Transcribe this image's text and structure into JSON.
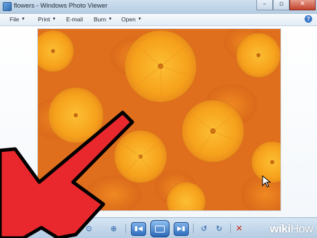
{
  "window": {
    "title": "flowers - Windows Photo Viewer",
    "controls": [
      "–",
      "▫",
      "✕"
    ]
  },
  "menu": {
    "items": [
      {
        "label": "File",
        "caret": "▼"
      },
      {
        "label": "Print",
        "caret": "▼"
      },
      {
        "label": "E-mail",
        "caret": ""
      },
      {
        "label": "Burn",
        "caret": "▼"
      },
      {
        "label": "Open",
        "caret": "▼"
      }
    ],
    "help": "?"
  },
  "photo": {
    "description_icon": "flowers-photo",
    "colors": {
      "background": "#e3771a",
      "petal": "#f7a01c",
      "petal_light": "#fbb52c",
      "center": "#c76a12"
    }
  },
  "toolbar": {
    "zoom_icon": "zoom-icon",
    "fit_icon": "actual-size-icon",
    "prev_icon": "previous-icon",
    "slideshow_icon": "slideshow-icon",
    "next_icon": "next-icon",
    "rotate_ccw_icon": "rotate-counterclockwise-icon",
    "rotate_cw_icon": "rotate-clockwise-icon",
    "delete_icon": "delete-icon"
  },
  "overlay": {
    "arrow_color": "#e8282d",
    "watermark_bold": "wiki",
    "watermark_light": "How"
  }
}
